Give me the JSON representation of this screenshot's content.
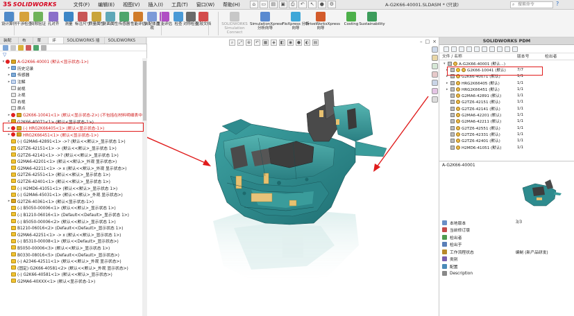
{
  "app": {
    "logo_mark": "3S",
    "logo_word": "SOLIDWORKS",
    "doc_title": "A-G2K66-40001.SLDASM * (只读)",
    "search_placeholder": "搜索命令",
    "help_icon": "question-icon"
  },
  "menu": [
    "文件(F)",
    "编辑(E)",
    "视图(V)",
    "插入(I)",
    "工具(T)",
    "窗口(W)",
    "帮助(H)"
  ],
  "command_manager": {
    "items": [
      {
        "label": "设计算例",
        "icon": "design-study-icon",
        "color": "#4f8ac9",
        "dim": false
      },
      {
        "label": "干涉检查",
        "icon": "interference-icon",
        "color": "#d6a23a",
        "dim": false
      },
      {
        "label": "间隙验证",
        "icon": "clearance-icon",
        "color": "#6fb35a",
        "dim": false
      },
      {
        "label": "孔对齐",
        "icon": "hole-align-icon",
        "color": "#8a6fc9",
        "dim": false
      },
      {
        "label": "测量",
        "icon": "measure-icon",
        "color": "#3d86c6",
        "dim": false
      },
      {
        "label": "标注尺寸",
        "icon": "dimension-icon",
        "color": "#c85656",
        "dim": false
      },
      {
        "label": "质量属性",
        "icon": "mass-icon",
        "color": "#c9a43a",
        "dim": false
      },
      {
        "label": "剖面属性",
        "icon": "section-icon",
        "color": "#5fa8b8",
        "dim": false
      },
      {
        "label": "传感器",
        "icon": "sensor-icon",
        "color": "#4ea56c",
        "dim": false
      },
      {
        "label": "性能评估",
        "icon": "performance-icon",
        "color": "#d07b2a",
        "dim": false
      },
      {
        "label": "装配体直观",
        "icon": "assembly-visual-icon",
        "color": "#7c9ad8",
        "dim": false
      },
      {
        "label": "性能评估",
        "icon": "eval-icon",
        "color": "#b04ec4",
        "dim": false
      },
      {
        "label": "检查",
        "icon": "check-icon",
        "color": "#4a9ad6",
        "dim": false
      },
      {
        "label": "对称检查",
        "icon": "symmetry-icon",
        "color": "#6a6a6a",
        "dim": false
      },
      {
        "label": "比较文档",
        "icon": "compare-icon",
        "color": "#d34c4c",
        "dim": false
      },
      {
        "label": "SOLIDWORKS Simulation Connect",
        "icon": "sim-connect-icon",
        "color": "#c7c7c7",
        "dim": true
      },
      {
        "label": "SimulationXpress 分析向导",
        "icon": "simxpress-icon",
        "color": "#5a8ad0",
        "dim": false
      },
      {
        "label": "FloXpress 分析向导",
        "icon": "floxpress-icon",
        "color": "#3fa7d8",
        "dim": false
      },
      {
        "label": "DriveWorksXpress 向导",
        "icon": "driveworks-icon",
        "color": "#d35b2b",
        "dim": false
      },
      {
        "label": "Costing",
        "icon": "costing-icon",
        "color": "#4db04a",
        "dim": false
      },
      {
        "label": "Sustainability",
        "icon": "sustainability-icon",
        "color": "#3c9c5b",
        "dim": false
      }
    ]
  },
  "tabs": [
    "装配体",
    "布局",
    "草图",
    "评估",
    "SOLIDWORKS 插件",
    "SOLIDWORKS MBD",
    "SAP PLM"
  ],
  "feature_tree": {
    "root": "A-G2K66-40001 (默认<显示状态-1>)",
    "items": [
      {
        "text": "历史记录",
        "icon": "fold",
        "indent": 1,
        "red": false,
        "warn": false
      },
      {
        "text": "传感器",
        "icon": "fold",
        "indent": 1,
        "red": false,
        "warn": false
      },
      {
        "text": "注解",
        "icon": "note",
        "indent": 1,
        "red": false,
        "warn": false
      },
      {
        "text": "前视",
        "icon": "plane",
        "indent": 1,
        "red": false,
        "warn": false
      },
      {
        "text": "上视",
        "icon": "plane",
        "indent": 1,
        "red": false,
        "warn": false
      },
      {
        "text": "右视",
        "icon": "plane",
        "indent": 1,
        "red": false,
        "warn": false
      },
      {
        "text": "原点",
        "icon": "plane",
        "indent": 1,
        "red": false,
        "warn": false
      },
      {
        "text": "G2K66-10041<1> (默认<显示状态-2>) (不包括在材料明细表中)",
        "icon": "asm",
        "indent": 1,
        "red": true,
        "warn": true
      },
      {
        "text": "G2K66-40071<1> (默认<显示状态-1>)",
        "icon": "asm",
        "indent": 1,
        "red": false,
        "warn": false
      },
      {
        "text": "(-) HRG2K66405<1> (默认<显示状态-1>)",
        "icon": "asm",
        "indent": 1,
        "red": true,
        "warn": true
      },
      {
        "text": "HRG2K66451<1> (默认<显示状态-1>)",
        "icon": "asm",
        "indent": 1,
        "red": true,
        "warn": true
      },
      {
        "text": "(-) G2MA6-42891<1> ->? (默认<<默认>_显示状态 1>)",
        "icon": "part",
        "indent": 1,
        "red": false,
        "warn": false
      },
      {
        "text": "G2TZ6-42151<1> -> (默认<<默认>_显示状态 1>)",
        "icon": "part",
        "indent": 1,
        "red": false,
        "warn": false
      },
      {
        "text": "G2TZ6-42141<1> ->? (默认<<默认>_显示状态 1>)",
        "icon": "part",
        "indent": 1,
        "red": false,
        "warn": false
      },
      {
        "text": "G2MA6-42201<1> (默认<<默认>_外观 显示状态>)",
        "icon": "part",
        "indent": 1,
        "red": false,
        "warn": false
      },
      {
        "text": "G2MA6-42211<1> -> x (默认<<默认>_外观 显示状态>)",
        "icon": "part",
        "indent": 1,
        "red": false,
        "warn": false
      },
      {
        "text": "G2TZ6-42551<1> (默认<<默认>_显示状态 1>)",
        "icon": "part",
        "indent": 1,
        "red": false,
        "warn": false
      },
      {
        "text": "G2TZ6-42401<1> (默认<<默认>_显示状态 1>)",
        "icon": "part",
        "indent": 1,
        "red": false,
        "warn": false
      },
      {
        "text": "(-) H2MD6-41051<1> (默认<<默认>_显示状态 1>)",
        "icon": "part",
        "indent": 1,
        "red": false,
        "warn": false
      },
      {
        "text": "(-) G2MA6-45031<1> (默认<<默认>_外观 显示状态>)",
        "icon": "part",
        "indent": 1,
        "red": false,
        "warn": false
      },
      {
        "text": "G2TZ6-40361<1> (默认<显示状态-1>)",
        "icon": "asm",
        "indent": 1,
        "red": false,
        "warn": false
      },
      {
        "text": "(-) B5050-00006<1> (默认<<默认>_显示状态 1>)",
        "icon": "part",
        "indent": 1,
        "red": false,
        "warn": false
      },
      {
        "text": "(-) B1210-06016<1> (Default<<Default>_显示状态 1>)",
        "icon": "part",
        "indent": 1,
        "red": false,
        "warn": false
      },
      {
        "text": "(-) B5050-00006<2> (默认<<默认>_显示状态 1>)",
        "icon": "part",
        "indent": 1,
        "red": false,
        "warn": false
      },
      {
        "text": "B1210-06016<2> (Default<<Default>_显示状态 1>)",
        "icon": "part",
        "indent": 1,
        "red": false,
        "warn": false
      },
      {
        "text": "G2MA6-42251<1> -> x (默认<<默认>_显示状态 1>)",
        "icon": "part",
        "indent": 1,
        "red": false,
        "warn": false
      },
      {
        "text": "(-) B5310-00008<1> (默认<<Default>_显示状态>)",
        "icon": "part",
        "indent": 1,
        "red": false,
        "warn": false
      },
      {
        "text": "B5050-00006<3> (默认<<默认>_显示状态 1>)",
        "icon": "part",
        "indent": 1,
        "red": false,
        "warn": false
      },
      {
        "text": "B0330-08016<5> (Default<<Default>_显示状态>)",
        "icon": "part",
        "indent": 1,
        "red": false,
        "warn": false
      },
      {
        "text": "(-) A2346-42511<1> (默认<<默认>_外观 显示状态>)",
        "icon": "part",
        "indent": 1,
        "red": false,
        "warn": false
      },
      {
        "text": "(固定) G2K66-40581<2> (默认<<默认>_外观 显示状态>)",
        "icon": "part",
        "indent": 1,
        "red": false,
        "warn": false
      },
      {
        "text": "(-) G2K66-40581<1> (默认<<默认>_显示状态>)",
        "icon": "part",
        "indent": 1,
        "red": false,
        "warn": false
      },
      {
        "text": "G2MA6-40XXX<1> (默认<显示状态-1>)",
        "icon": "part",
        "indent": 1,
        "red": false,
        "warn": false
      }
    ]
  },
  "viewport": {
    "tool_icons": [
      "search-view-icon",
      "zoom-fit-icon",
      "zoom-area-icon",
      "prev-view-icon",
      "section-view-icon",
      "view-orient-icon",
      "display-style-icon",
      "hide-show-icon",
      "appearance-icon",
      "scene-icon",
      "view-settings-icon"
    ],
    "tool_glyphs": [
      "⌕",
      "⤢",
      "⊕",
      "↶",
      "▦",
      "◈",
      "◧",
      "◉",
      "●",
      "◐",
      "▤"
    ],
    "window_glyphs": [
      "–",
      "□",
      "×"
    ]
  },
  "pdm": {
    "title": "SOLIDWORKS PDM",
    "columns": [
      "文件 / 名称",
      "版本号",
      "检出者"
    ],
    "rows": [
      {
        "name": "A-G2K66-40001 (默认...)",
        "version": "",
        "checkout": "",
        "warn": false,
        "expand": "▾"
      },
      {
        "name": "G2K66-10041 (默认)",
        "version": "7/7",
        "checkout": "",
        "warn": true,
        "expand": "▸"
      },
      {
        "name": "G2K66-40071 (默认)",
        "version": "1/1",
        "checkout": "",
        "warn": false,
        "expand": "▸"
      },
      {
        "name": "HRG2K66405 (默认)",
        "version": "1/1",
        "checkout": "",
        "warn": false,
        "expand": "▸"
      },
      {
        "name": "HRG2K66451 (默认)",
        "version": "1/1",
        "checkout": "",
        "warn": false,
        "expand": "▸"
      },
      {
        "name": "G2MA6-42891 (默认)",
        "version": "1/1",
        "checkout": "",
        "warn": false,
        "expand": ""
      },
      {
        "name": "G2TZ6-42151 (默认)",
        "version": "1/1",
        "checkout": "",
        "warn": false,
        "expand": ""
      },
      {
        "name": "G2TZ6-42141 (默认)",
        "version": "1/1",
        "checkout": "",
        "warn": false,
        "expand": ""
      },
      {
        "name": "G2MA6-42201 (默认)",
        "version": "1/1",
        "checkout": "",
        "warn": false,
        "expand": ""
      },
      {
        "name": "G2MA6-42211 (默认)",
        "version": "1/1",
        "checkout": "",
        "warn": false,
        "expand": ""
      },
      {
        "name": "G2TZ6-42551 (默认)",
        "version": "1/1",
        "checkout": "",
        "warn": false,
        "expand": ""
      },
      {
        "name": "G2TZ6-42331 (默认)",
        "version": "1/1",
        "checkout": "",
        "warn": false,
        "expand": ""
      },
      {
        "name": "G2TZ6-42401 (默认)",
        "version": "1/1",
        "checkout": "",
        "warn": false,
        "expand": ""
      },
      {
        "name": "H2MD6-41051 (默认)",
        "version": "1/1",
        "checkout": "",
        "warn": false,
        "expand": ""
      }
    ],
    "selected_name": "A-G2K66-40001",
    "properties": [
      {
        "key": "本地版本",
        "value": "3/3",
        "icon": "local-version-icon",
        "color": "#6a8fc7"
      },
      {
        "key": "当前修订版",
        "value": "",
        "icon": "revision-icon",
        "color": "#c44a4a"
      },
      {
        "key": "检出者",
        "value": "",
        "icon": "checked-out-by-icon",
        "color": "#4f9a4f"
      },
      {
        "key": "检出于",
        "value": "",
        "icon": "checked-out-at-icon",
        "color": "#5a7fb8"
      },
      {
        "key": "工作流程状态",
        "value": "编制 (新产品研发)",
        "icon": "workflow-state-icon",
        "color": "#b8892c"
      },
      {
        "key": "类别",
        "value": "",
        "icon": "category-icon",
        "color": "#7a5fb0"
      },
      {
        "key": "配置",
        "value": "",
        "icon": "configuration-icon",
        "color": "#4a8ab8"
      },
      {
        "key": "Description",
        "value": "",
        "icon": "description-icon",
        "color": "#888888"
      }
    ]
  },
  "colors": {
    "model_teal": "#2e8b8e",
    "highlight_red": "#e01b1b",
    "brand_red": "#d6001c"
  }
}
